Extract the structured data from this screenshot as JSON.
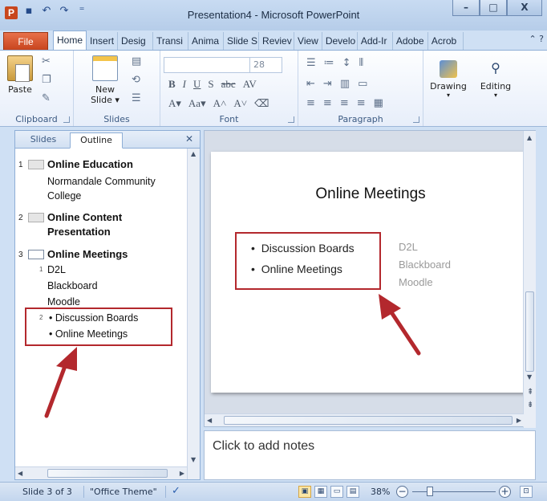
{
  "window": {
    "title": "Presentation4 - Microsoft PowerPoint",
    "minimize_glyph": "–",
    "maximize_glyph": "□",
    "close_glyph": "X"
  },
  "ribbon_tabs": [
    {
      "label": "File"
    },
    {
      "label": "Home"
    },
    {
      "label": "Insert"
    },
    {
      "label": "Desig"
    },
    {
      "label": "Transi"
    },
    {
      "label": "Anima"
    },
    {
      "label": "Slide S"
    },
    {
      "label": "Reviev"
    },
    {
      "label": "View"
    },
    {
      "label": "Develo"
    },
    {
      "label": "Add-Ir"
    },
    {
      "label": "Adobe"
    },
    {
      "label": "Acrob"
    }
  ],
  "ribbon": {
    "clipboard": {
      "label": "Clipboard",
      "paste_label": "Paste"
    },
    "slides": {
      "label": "Slides",
      "new_slide_label": "New Slide ▾"
    },
    "font": {
      "label": "Font",
      "font_size": "28"
    },
    "paragraph": {
      "label": "Paragraph"
    },
    "drawing_label": "Drawing",
    "editing_label": "Editing"
  },
  "left_pane": {
    "tabs": [
      {
        "label": "Slides"
      },
      {
        "label": "Outline"
      }
    ],
    "close_glyph": "✕",
    "slides": [
      {
        "number": "1",
        "title": "Online  Education",
        "lines": [
          "Normandale Community",
          "College"
        ]
      },
      {
        "number": "2",
        "title": "Online  Content",
        "title2": "Presentation"
      },
      {
        "number": "3",
        "title": "Online  Meetings",
        "lines": [
          "D2L",
          "Blackboard",
          "Moodle"
        ],
        "bullets": [
          "Discussion Boards",
          "Online Meetings"
        ]
      }
    ],
    "level_glyph_1": "1",
    "level_glyph_2": "2"
  },
  "slide": {
    "title": "Online Meetings",
    "bullets": [
      "Discussion Boards",
      "Online Meetings"
    ],
    "right_text": [
      "D2L",
      "Blackboard",
      "Moodle"
    ]
  },
  "notes": {
    "placeholder": "Click to add notes"
  },
  "status": {
    "slide_info": "Slide 3 of 3",
    "theme": "\"Office Theme\"",
    "zoom": "38%"
  },
  "colors": {
    "highlight": "#b3282d",
    "file_tab": "#c8451e",
    "arrow": "#b3282d"
  }
}
